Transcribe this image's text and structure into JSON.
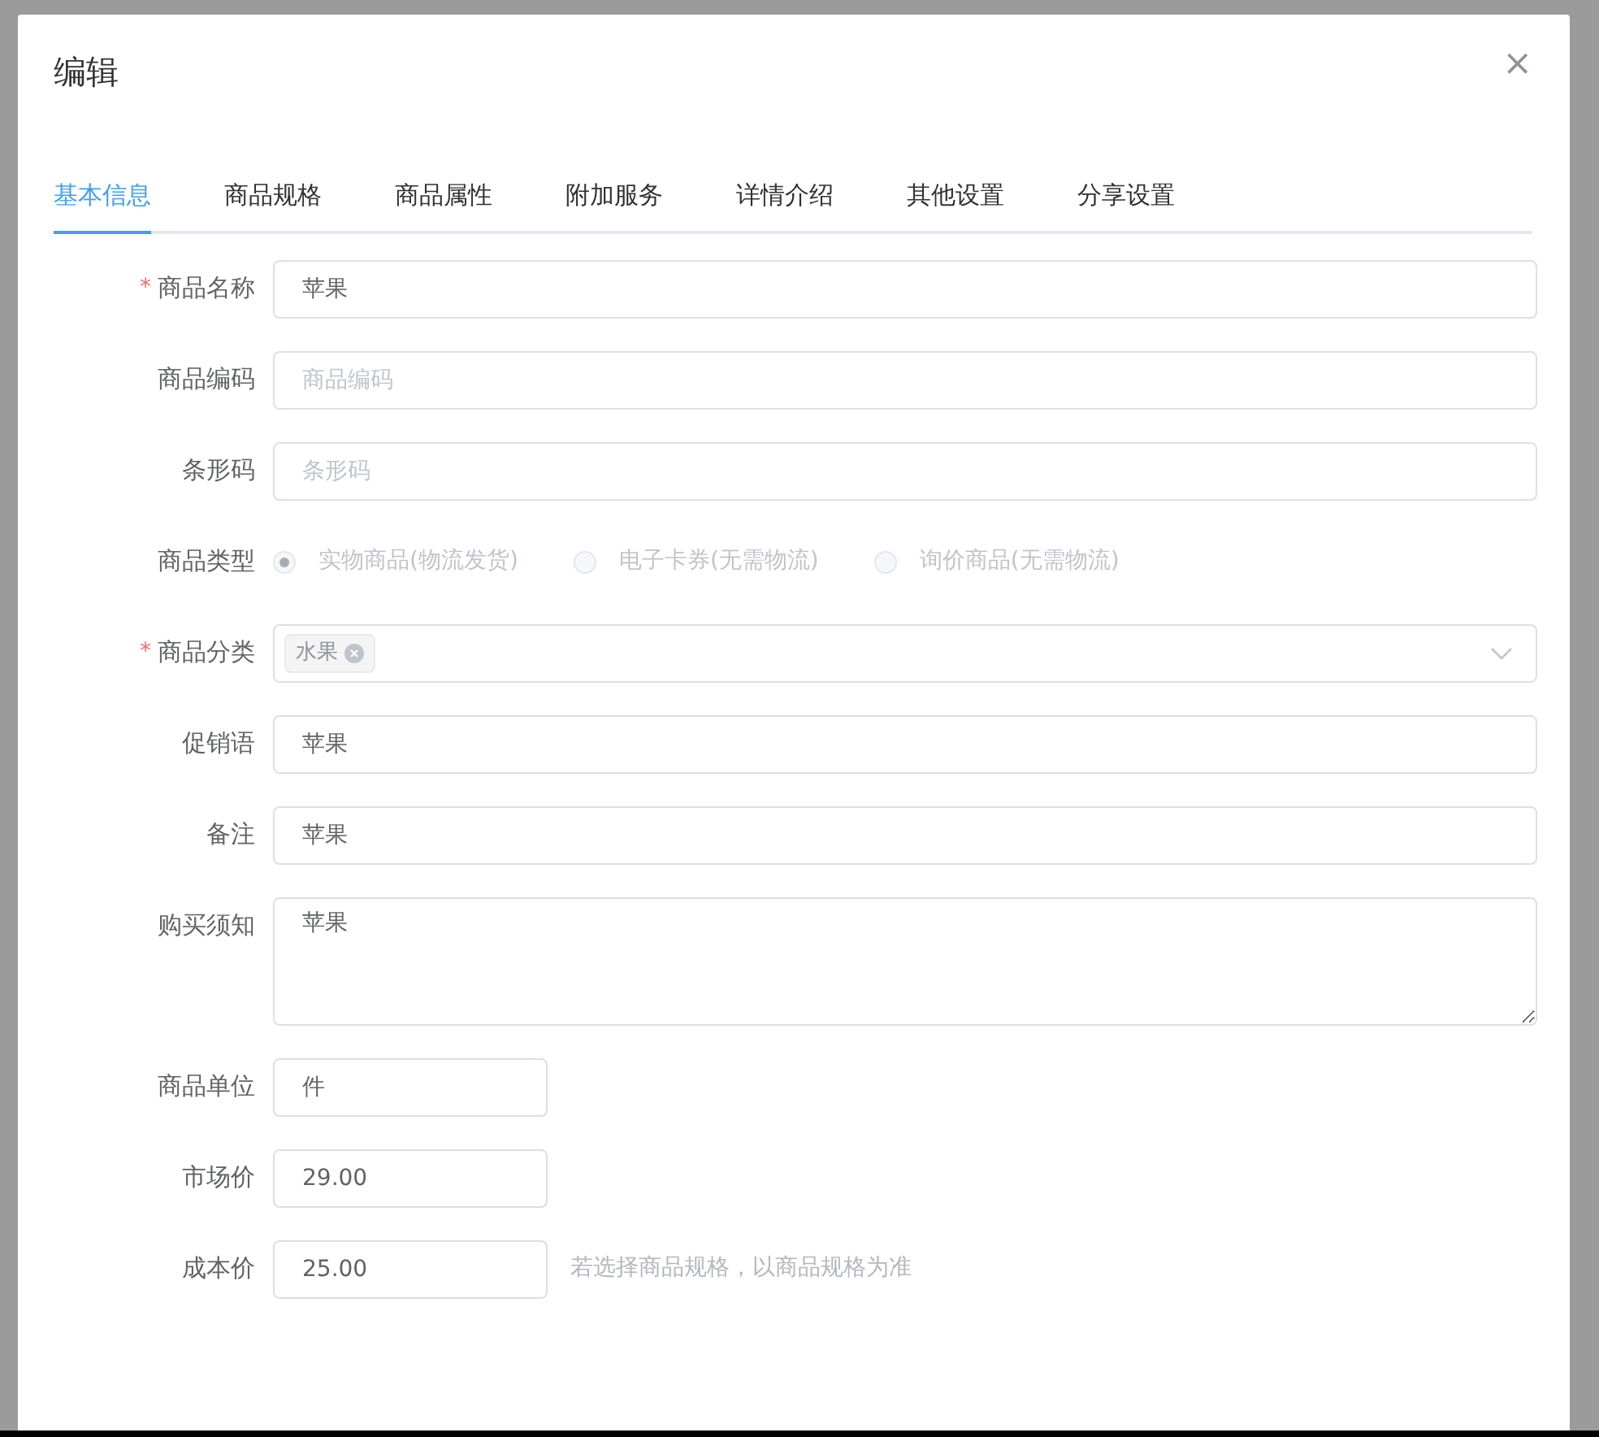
{
  "dialog": {
    "title": "编辑",
    "close": "×"
  },
  "tabs": [
    {
      "label": "基本信息",
      "selected": true
    },
    {
      "label": "商品规格",
      "selected": false
    },
    {
      "label": "商品属性",
      "selected": false
    },
    {
      "label": "附加服务",
      "selected": false
    },
    {
      "label": "详情介绍",
      "selected": false
    },
    {
      "label": "其他设置",
      "selected": false
    },
    {
      "label": "分享设置",
      "selected": false
    }
  ],
  "fields": [
    {
      "kind": "text",
      "label": "商品名称",
      "required_mark": "*",
      "value": "苹果"
    },
    {
      "kind": "text",
      "label": "商品编码",
      "placeholder": "商品编码"
    },
    {
      "kind": "text",
      "label": "条形码",
      "placeholder": "条形码"
    },
    {
      "kind": "radio",
      "label": "商品类型",
      "disabled": true,
      "options": [
        {
          "label": "实物商品(物流发货)",
          "selected": true
        },
        {
          "label": "电子卡券(无需物流)",
          "selected": false
        },
        {
          "label": "询价商品(无需物流)",
          "selected": false
        }
      ]
    },
    {
      "kind": "select",
      "label": "商品分类",
      "required_mark": "*",
      "tags": [
        "水果"
      ]
    },
    {
      "kind": "text",
      "label": "促销语",
      "value": "苹果"
    },
    {
      "kind": "text",
      "label": "备注",
      "value": "苹果"
    },
    {
      "kind": "textarea",
      "label": "购买须知",
      "value": "苹果"
    },
    {
      "kind": "short",
      "label": "商品单位",
      "value": "件"
    },
    {
      "kind": "short",
      "label": "市场价",
      "value": "29.00"
    },
    {
      "kind": "short",
      "label": "成本价",
      "value": "25.00",
      "hint": "若选择商品规格，以商品规格为准"
    }
  ]
}
